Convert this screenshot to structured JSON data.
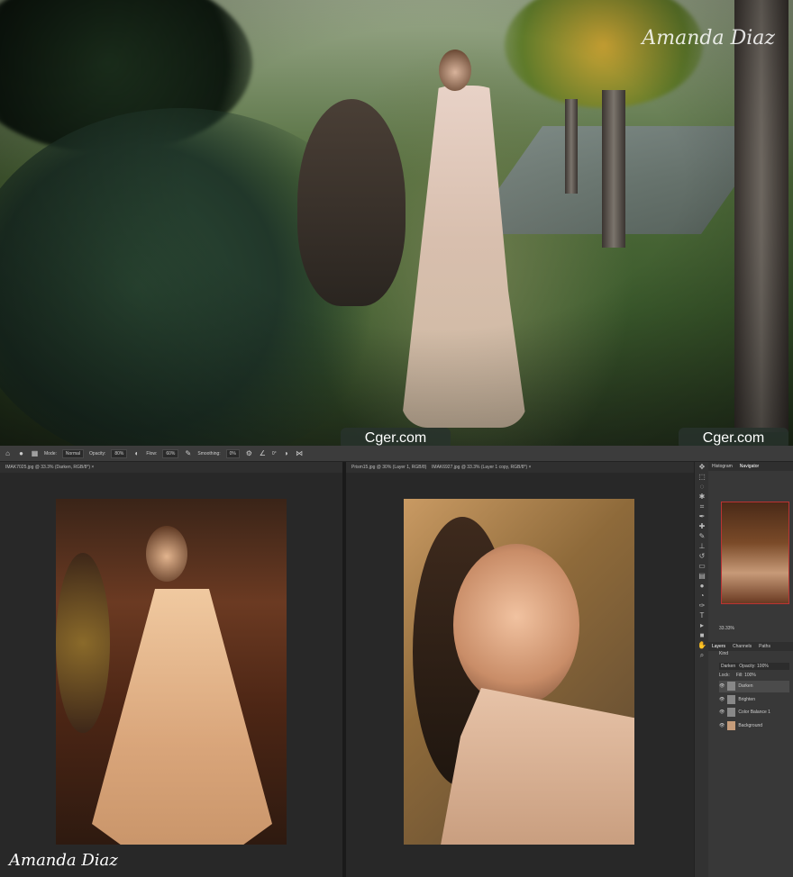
{
  "hero": {
    "signature": "Amanda Diaz",
    "badge_left": "Cger.com",
    "badge_right": "Cger.com"
  },
  "options_bar": {
    "mode_label": "Mode:",
    "mode_value": "Normal",
    "opacity_label": "Opacity:",
    "opacity_value": "80%",
    "flow_label": "Flow:",
    "flow_value": "60%",
    "smoothing_label": "Smoothing:",
    "smoothing_value": "0%",
    "angle_value": "0°"
  },
  "documents": {
    "left_tab": "IMAK7025.jpg @ 33.3% (Darken, RGB/8*) ×",
    "right_tab_1": "Prism15.jpg @ 30% (Layer 1, RGB/8)",
    "right_tab_2": "IMAK6927.jpg @ 33.3% (Layer 1 copy, RGB/8*) ×",
    "left_signature": "Amanda Diaz"
  },
  "panels": {
    "navigator_tabs": [
      "Histogram",
      "Navigator"
    ],
    "zoom": "33.33%",
    "layers_tabs": [
      "Layers",
      "Channels",
      "Paths"
    ],
    "kind": "Kind",
    "blend_mode": "Darken",
    "opacity_label": "Opacity: 100%",
    "lock_label": "Lock:",
    "fill_label": "Fill: 100%",
    "layers": [
      {
        "name": "Darken",
        "selected": true
      },
      {
        "name": "Brighten",
        "selected": false
      },
      {
        "name": "Color Balance 1",
        "selected": false
      },
      {
        "name": "Background",
        "selected": false
      }
    ]
  },
  "tool_icons": [
    "move-icon",
    "marquee-icon",
    "lasso-icon",
    "quick-select-icon",
    "crop-icon",
    "eyedropper-icon",
    "healing-icon",
    "brush-icon",
    "stamp-icon",
    "history-brush-icon",
    "eraser-icon",
    "gradient-icon",
    "blur-icon",
    "dodge-icon",
    "pen-icon",
    "type-icon",
    "path-select-icon",
    "shape-icon",
    "hand-icon",
    "zoom-icon"
  ]
}
